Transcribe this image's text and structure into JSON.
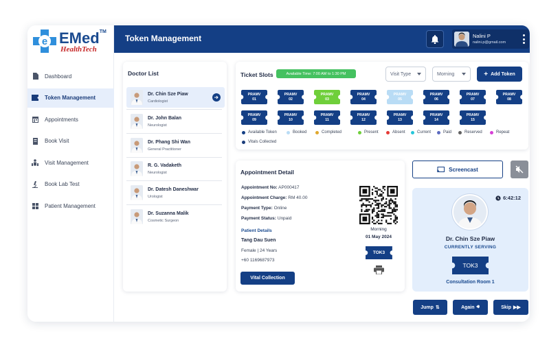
{
  "brand": {
    "name": "EMed",
    "tm": "TM",
    "tagline": "HealthTech",
    "color": "#143f85",
    "accent": "#c62828"
  },
  "header": {
    "title": "Token Management"
  },
  "user": {
    "name": "Nalini P",
    "email": "nalini.p@gmail.com"
  },
  "sidebar": {
    "items": [
      {
        "label": "Dashboard",
        "icon": "document-icon"
      },
      {
        "label": "Token Management",
        "icon": "ticket-icon",
        "active": true
      },
      {
        "label": "Appointments",
        "icon": "calendar-icon"
      },
      {
        "label": "Book Visit",
        "icon": "page-icon"
      },
      {
        "label": "Visit Management",
        "icon": "people-icon"
      },
      {
        "label": "Book Lab Test",
        "icon": "microscope-icon"
      },
      {
        "label": "Patient Management",
        "icon": "grid-icon"
      }
    ]
  },
  "doctor_list": {
    "title": "Doctor List",
    "doctors": [
      {
        "name": "Dr. Chin Sze Piaw",
        "specialty": "Cardiologist",
        "selected": true
      },
      {
        "name": "Dr. John Balan",
        "specialty": "Neurologist"
      },
      {
        "name": "Dr. Phang Shi Wan",
        "specialty": "General Practitioner"
      },
      {
        "name": "R. G. Vadaketh",
        "specialty": "Neurologist"
      },
      {
        "name": "Dr. Datesh Daneshwar",
        "specialty": "Urologist"
      },
      {
        "name": "Dr. Suzanna Malik",
        "specialty": "Cosmetic Surgeon"
      }
    ]
  },
  "slots": {
    "title": "Ticket Slots",
    "available_time": "Available Time: 7:00 AM to 1:30 PM",
    "visit_type": "Visit Type",
    "session": "Morning",
    "add_label": "Add Token",
    "tokens": [
      {
        "code": "PRAMV",
        "num": "01",
        "status": "available"
      },
      {
        "code": "PRAMV",
        "num": "02",
        "status": "available"
      },
      {
        "code": "PRAMV",
        "num": "03",
        "status": "present"
      },
      {
        "code": "PRAMV",
        "num": "04",
        "status": "available"
      },
      {
        "code": "PRAMV",
        "num": "05",
        "status": "booked"
      },
      {
        "code": "PRAMV",
        "num": "06",
        "status": "available"
      },
      {
        "code": "PRAMV",
        "num": "07",
        "status": "available"
      },
      {
        "code": "PRAMV",
        "num": "08",
        "status": "available"
      },
      {
        "code": "PRAMV",
        "num": "09",
        "status": "available"
      },
      {
        "code": "PRAMV",
        "num": "10",
        "status": "available"
      },
      {
        "code": "PRAMV",
        "num": "11",
        "status": "available"
      },
      {
        "code": "PRAMV",
        "num": "12",
        "status": "available"
      },
      {
        "code": "PRAMV",
        "num": "13",
        "status": "available"
      },
      {
        "code": "PRAMV",
        "num": "14",
        "status": "available"
      },
      {
        "code": "PRAMV",
        "num": "15",
        "status": "available"
      }
    ],
    "legend": [
      {
        "label": "Available Token",
        "color": "#143f85"
      },
      {
        "label": "Booked",
        "color": "#b9dcf5"
      },
      {
        "label": "Completed",
        "color": "#e0a82e"
      },
      {
        "label": "Present",
        "color": "#6fcf3a"
      },
      {
        "label": "Absent",
        "color": "#e53935"
      },
      {
        "label": "Current",
        "color": "#26c6da"
      },
      {
        "label": "Paid",
        "color": "#5c6bc0"
      },
      {
        "label": "Reserved",
        "color": "#616161"
      },
      {
        "label": "Repeat",
        "color": "#d63fd6"
      },
      {
        "label": "Vitals Collected",
        "color": "#1a3c7a"
      }
    ],
    "status_colors": {
      "available": "#143f85",
      "booked": "#b9dcf5",
      "present": "#6fcf3a"
    }
  },
  "appointment": {
    "title": "Appointment Detail",
    "no_label": "Appointment No:",
    "no_value": "AP000417",
    "charge_label": "Appointment Charge:",
    "charge_value": "RM 40.00",
    "ptype_label": "Payment Type:",
    "ptype_value": "Online",
    "pstatus_label": "Payment Status:",
    "pstatus_value": "Unpaid",
    "patient_heading": "Patient Details",
    "patient_name": "Tang Dau Suen",
    "patient_info": "Female | 24 Years",
    "patient_phone": "+60 1169687973",
    "vital_label": "Vital Collection",
    "session": "Morning",
    "date": "01 May 2024",
    "token": "TOK3"
  },
  "serving": {
    "screencast_label": "Screencast",
    "timer": "6:42:12",
    "doctor": "Dr. Chin Sze Piaw",
    "status": "CURRENTLY SERVING",
    "token": "TOK3",
    "room": "Consultation Room 1"
  },
  "actions": {
    "jump": "Jump",
    "again": "Again",
    "skip": "Skip"
  }
}
